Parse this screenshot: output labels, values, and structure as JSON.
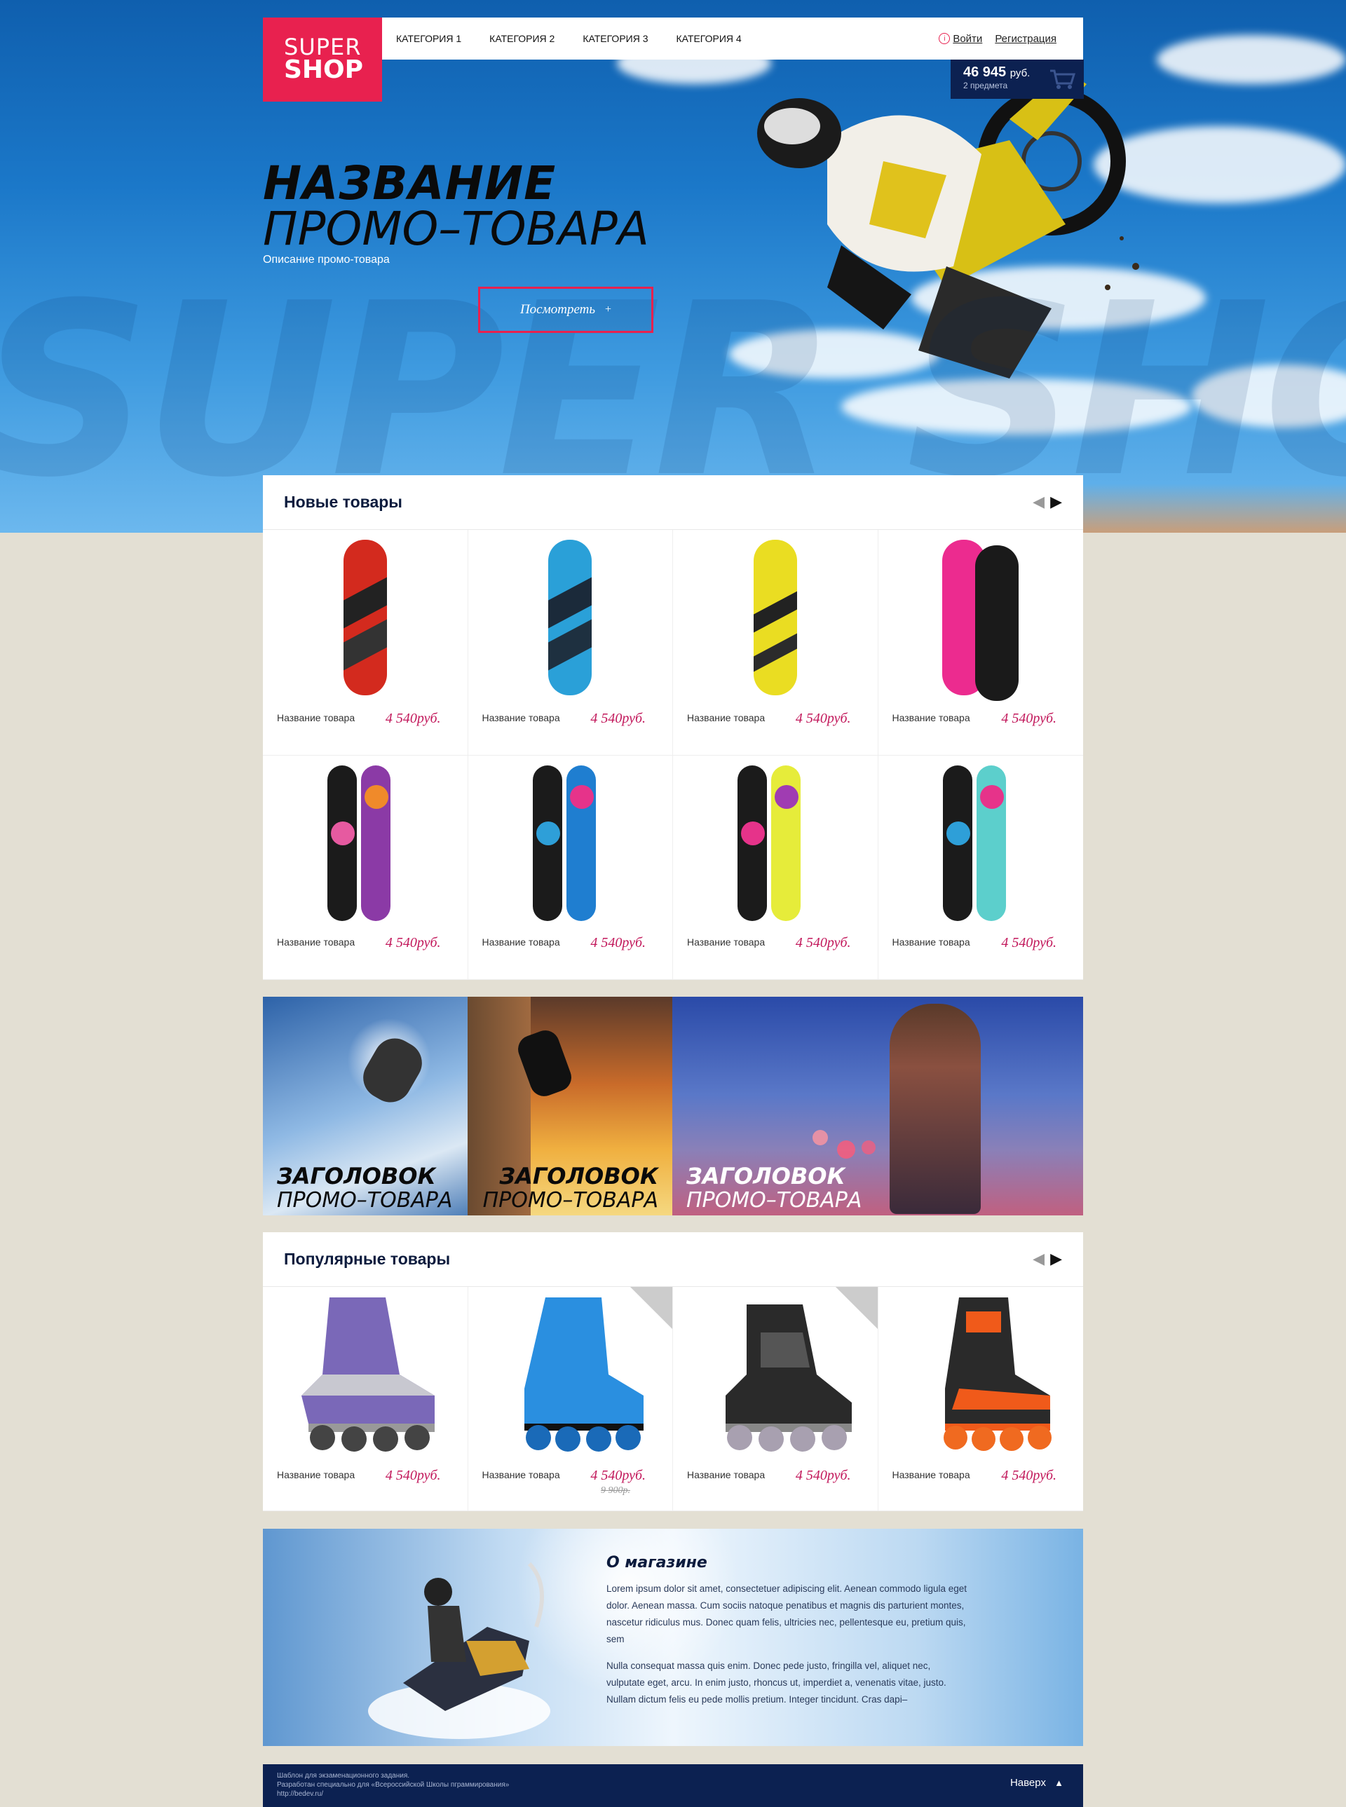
{
  "logo": {
    "line1": "SUPER",
    "line2": "SHOP"
  },
  "nav": {
    "items": [
      "КАТЕГОРИЯ 1",
      "КАТЕГОРИЯ 2",
      "КАТЕГОРИЯ 3",
      "КАТЕГОРИЯ 4"
    ]
  },
  "auth": {
    "login": "Войти",
    "register": "Регистрация"
  },
  "cart": {
    "sum": "46 945",
    "currency": "руб.",
    "count": "2 предмета",
    "icon": "cart-icon"
  },
  "hero": {
    "title_bold": "НАЗВАНИЕ",
    "title_light": "ПРОМО–ТОВАРА",
    "description": "Описание промо-товара",
    "button": "Посмотреть",
    "button_icon": "+"
  },
  "new_products": {
    "title": "Новые товары",
    "items": [
      {
        "name": "Название товара",
        "price": "4 540руб."
      },
      {
        "name": "Название товара",
        "price": "4 540руб."
      },
      {
        "name": "Название товара",
        "price": "4 540руб."
      },
      {
        "name": "Название товара",
        "price": "4 540руб."
      },
      {
        "name": "Название товара",
        "price": "4 540руб."
      },
      {
        "name": "Название товара",
        "price": "4 540руб."
      },
      {
        "name": "Название товара",
        "price": "4 540руб."
      },
      {
        "name": "Название товара",
        "price": "4 540руб."
      }
    ]
  },
  "banners": [
    {
      "bold": "ЗАГОЛОВОК",
      "light": "ПРОМО–ТОВАРА"
    },
    {
      "bold": "ЗАГОЛОВОК",
      "light": "ПРОМО–ТОВАРА"
    },
    {
      "bold": "ЗАГОЛОВОК",
      "light": "ПРОМО–ТОВАРА"
    }
  ],
  "popular_products": {
    "title": "Популярные товары",
    "items": [
      {
        "name": "Название товара",
        "price": "4 540руб.",
        "old_price": ""
      },
      {
        "name": "Название товара",
        "price": "4 540руб.",
        "old_price": "9 900р."
      },
      {
        "name": "Название товара",
        "price": "4 540руб.",
        "old_price": ""
      },
      {
        "name": "Название товара",
        "price": "4 540руб.",
        "old_price": ""
      }
    ]
  },
  "about": {
    "title": "О магазине",
    "p1": "Lorem ipsum dolor sit amet, consectetuer adipiscing elit. Aenean commodo ligula eget dolor. Aenean massa. Cum sociis natoque penatibus et magnis dis parturient montes, nascetur ridiculus mus. Donec quam felis, ultricies nec, pellentesque eu, pretium quis, sem",
    "p2": "Nulla consequat massa quis enim. Donec pede justo, fringilla vel, aliquet nec, vulputate eget, arcu. In enim justo, rhoncus ut, imperdiet a, venenatis vitae, justo. Nullam dictum felis eu pede mollis pretium. Integer tincidunt. Cras dapi–"
  },
  "footer": {
    "line1": "Шаблон для экзаменационного задания.",
    "line2": "Разработан специально для «Всероссийской Школы пграммирования»",
    "line3": "http://bedev.ru/",
    "up": "Наверх",
    "up_icon": "▲"
  },
  "colors": {
    "accent": "#e8214f",
    "navy": "#0c2151",
    "price": "#c2185b",
    "bg": "#e3dfd3"
  }
}
